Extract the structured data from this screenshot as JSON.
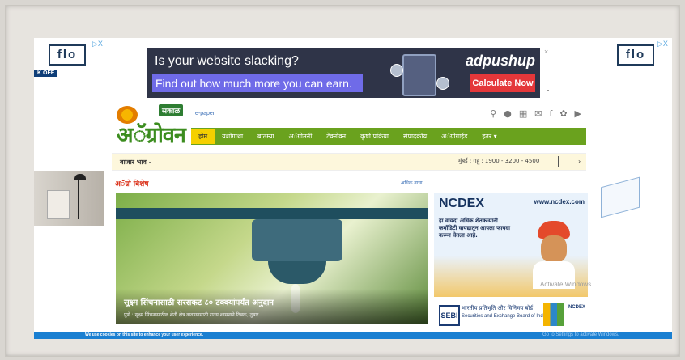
{
  "side_ads": {
    "left_logo": "flo",
    "right_logo": "flo",
    "adchoice": "▷X",
    "off_badge": "K OFF"
  },
  "top_ad": {
    "headline": "Is your website slacking?",
    "subline": "Find out how much more you can earn.",
    "brand": "adpushup",
    "cta": "Calculate Now"
  },
  "site": {
    "logo_badge": "सकाळ",
    "logo_text": "अॅग्रोवन",
    "epaper": "e-paper",
    "nav": [
      "होम",
      "यशोगाथा",
      "बातम्या",
      "अॅग्रोमनी",
      "टेक्नोवन",
      "कृषी प्रक्रिया",
      "संपादकीय",
      "अॅग्रोगाईड",
      "इतर ▾"
    ],
    "market_label": "बाजार भाव -",
    "market_ticker": "मुंबई : गहू : 1900 - 3200 - 4500",
    "section_title": "अॅग्रो विशेष",
    "more_link": "अधिक वाचा",
    "hero_headline": "सूक्ष्म सिंचनासाठी सरसकट ८० टक्क्यांपर्यंत अनुदान",
    "hero_sub": "पुणे : सूक्ष्म सिंचनासाठील शेती क्षेत्र वाढण्यासाठी राज्य शासनाने ठिबक, तुषार..."
  },
  "ncdex_ad": {
    "title": "NCDEX",
    "url": "www.ncdex.com",
    "copy": "हा वायदा अधिक शेतकऱ्यांनी कमॉडिटी वायद्यातून आपला फायदा करून घेतला आहे."
  },
  "sebi_ad": {
    "hindi": "भारतीय प्रतिभूति और विनिमय बोर्ड",
    "english": "Securities and Exchange Board of India",
    "brand": "NCDEX"
  },
  "cookie_bar": {
    "text": "We use cookies on this site to enhance your user experience.",
    "windows": "Go to Settings to activate Windows."
  },
  "activate": "Activate Windows"
}
